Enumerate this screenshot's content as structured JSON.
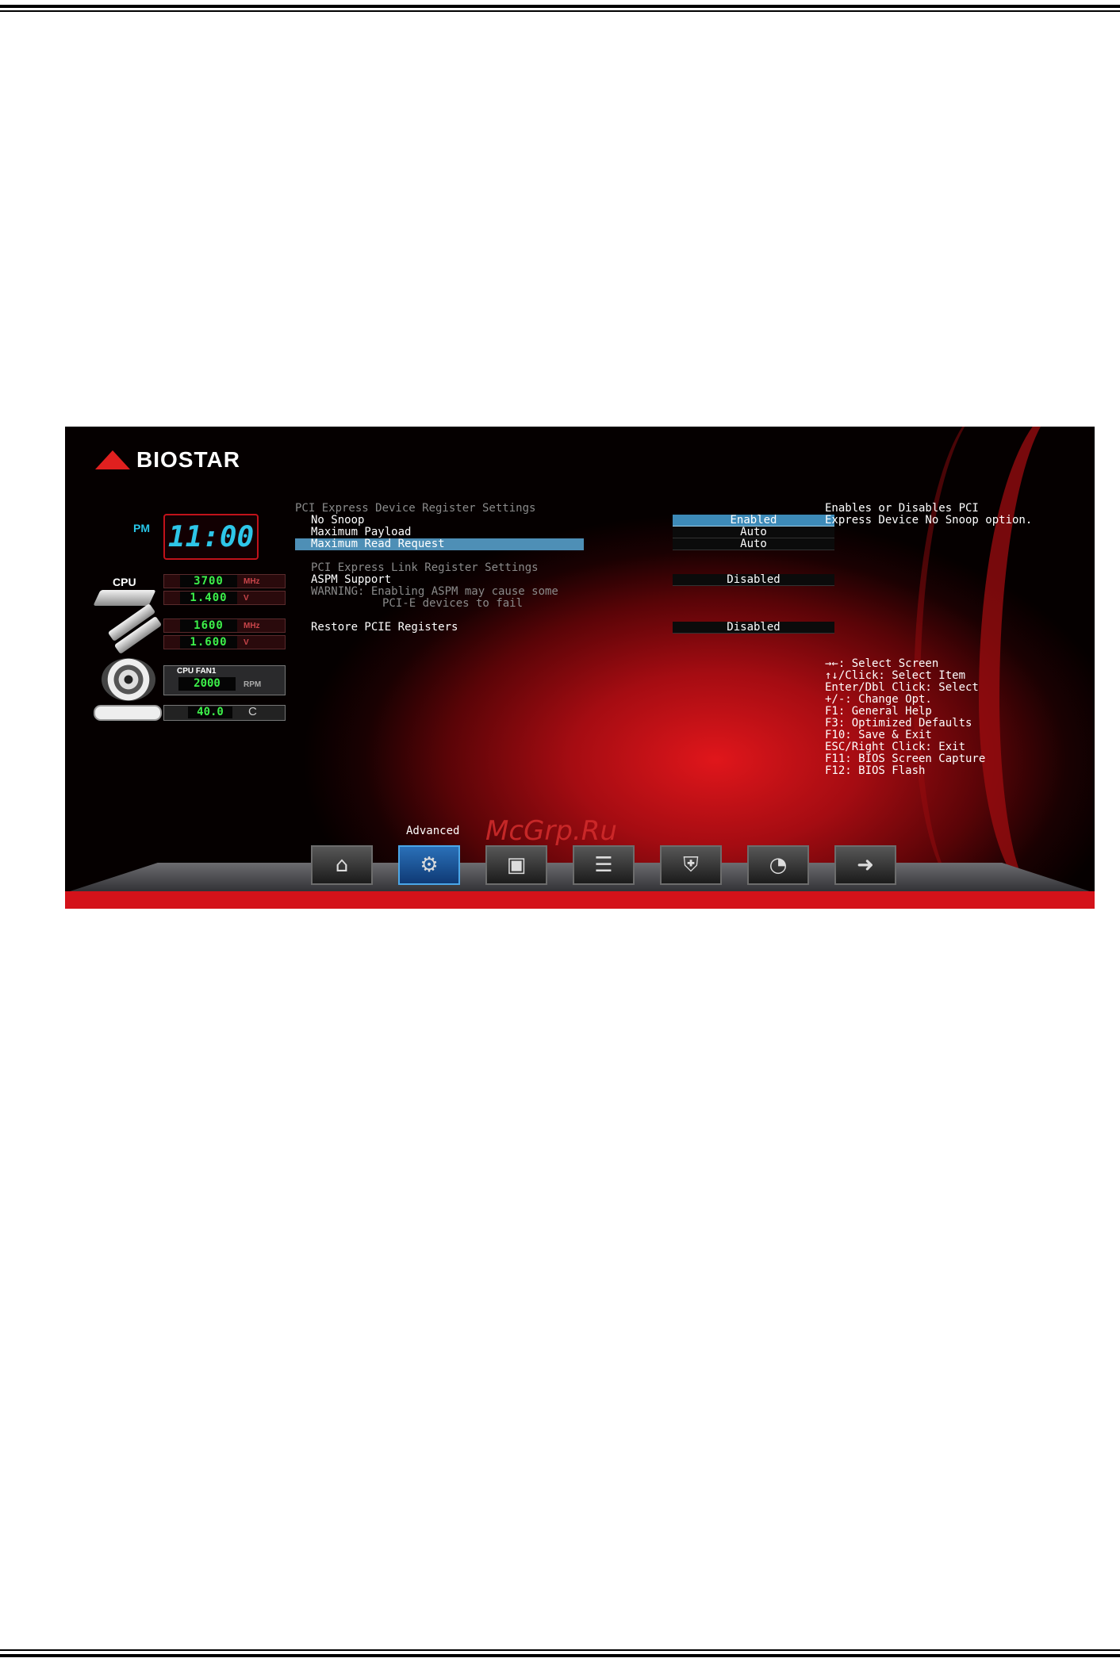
{
  "brand": {
    "logo_text": "BIOSTAR"
  },
  "monitor": {
    "clock": {
      "ampm": "PM",
      "time": "11:00"
    },
    "cpu": {
      "label": "CPU",
      "freq": "3700",
      "freq_unit": "MHz",
      "volt": "1.400",
      "volt_unit": "V"
    },
    "memory": {
      "freq": "1600",
      "freq_unit": "MHz",
      "volt": "1.600",
      "volt_unit": "V"
    },
    "fan": {
      "title": "CPU FAN1",
      "rpm": "2000",
      "unit": "RPM"
    },
    "temp": {
      "value": "40.0",
      "unit": "C"
    }
  },
  "settings": {
    "section1": "PCI Express Device Register Settings",
    "no_snoop": {
      "label": "No Snoop",
      "value": "Enabled"
    },
    "max_payload": {
      "label": "Maximum Payload",
      "value": "Auto"
    },
    "max_read": {
      "label": "Maximum Read Request",
      "value": "Auto"
    },
    "section2": "PCI Express Link Register Settings",
    "aspm": {
      "label": "ASPM Support",
      "value": "Disabled"
    },
    "warning_line1": "WARNING: Enabling ASPM may cause some",
    "warning_line2": "PCI-E devices to fail",
    "restore": {
      "label": "Restore PCIE Registers",
      "value": "Disabled"
    }
  },
  "help": {
    "line1": "Enables or Disables PCI",
    "line2": "Express Device No Snoop option."
  },
  "keys": [
    "→←: Select Screen",
    "↑↓/Click: Select Item",
    "Enter/Dbl Click: Select",
    "+/-: Change Opt.",
    "F1: General Help",
    "F3: Optimized Defaults",
    "F10: Save & Exit",
    "ESC/Right Click: Exit",
    "F11: BIOS Screen Capture",
    "F12: BIOS Flash"
  ],
  "nav": {
    "active_tab_label": "Advanced",
    "tabs": [
      {
        "name": "main",
        "icon": "home-icon",
        "glyph": "⌂"
      },
      {
        "name": "advanced",
        "icon": "tool-icon",
        "glyph": "⚙"
      },
      {
        "name": "chipset",
        "icon": "chip-icon",
        "glyph": "▣"
      },
      {
        "name": "boot",
        "icon": "drive-icon",
        "glyph": "☰"
      },
      {
        "name": "security",
        "icon": "shield-icon",
        "glyph": "⛨"
      },
      {
        "name": "o-n-e",
        "icon": "performance-icon",
        "glyph": "◔"
      },
      {
        "name": "save-exit",
        "icon": "folder-exit-icon",
        "glyph": "➜"
      }
    ]
  },
  "watermark": "McGrp.Ru"
}
